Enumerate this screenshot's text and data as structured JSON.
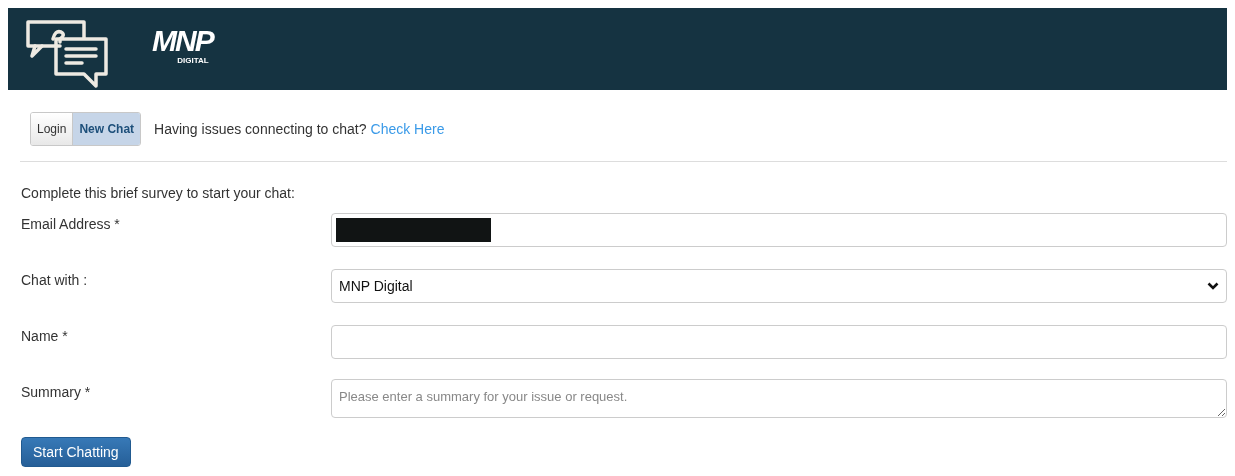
{
  "header": {
    "logo_text": "MNP",
    "logo_subtext": "DIGITAL"
  },
  "tabs": [
    {
      "label": "Login",
      "selected": false
    },
    {
      "label": "New Chat",
      "selected": true
    }
  ],
  "notice": {
    "text": "Having issues connecting to chat?",
    "link": "Check Here"
  },
  "intro": "Complete this brief survey to start your chat:",
  "fields": [
    {
      "kind": "email",
      "label": "Email Address *",
      "redacted": true
    },
    {
      "kind": "select",
      "label": "Chat with :",
      "value": "MNP Digital"
    },
    {
      "kind": "text",
      "label": "Name *"
    },
    {
      "kind": "textarea",
      "label": "Summary *",
      "placeholder": "Please enter a summary for your issue or request."
    }
  ],
  "submit": "Start Chatting"
}
